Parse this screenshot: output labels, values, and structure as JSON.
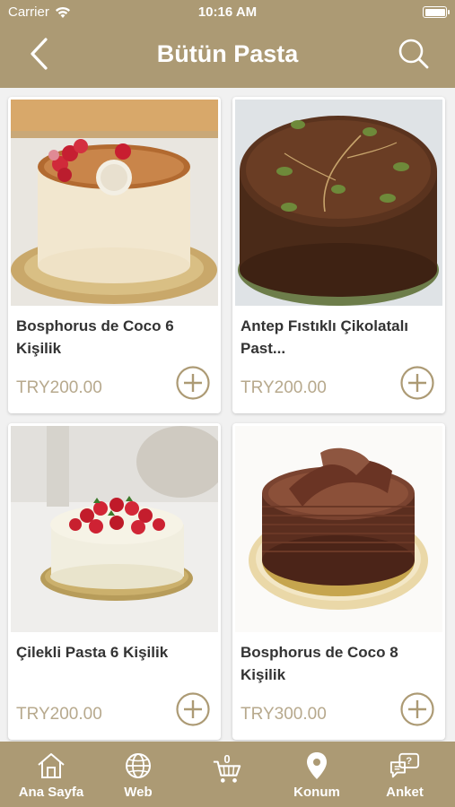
{
  "status_bar": {
    "carrier": "Carrier",
    "time": "10:16 AM"
  },
  "header": {
    "title": "Bütün Pasta",
    "back_icon": "chevron-left-icon",
    "search_icon": "search-icon"
  },
  "products": [
    {
      "name": "Bosphorus de Coco 6 Kişilik",
      "price": "TRY200.00"
    },
    {
      "name": "Antep Fıstıklı Çikolatalı Past...",
      "price": "TRY200.00"
    },
    {
      "name": "Çilekli Pasta 6 Kişilik",
      "price": "TRY200.00"
    },
    {
      "name": "Bosphorus de Coco 8 Kişilik",
      "price": "TRY300.00"
    }
  ],
  "tabbar": {
    "items": [
      {
        "label": "Ana Sayfa",
        "icon": "home-icon"
      },
      {
        "label": "Web",
        "icon": "globe-icon"
      },
      {
        "label": "",
        "icon": "cart-icon",
        "badge": "0"
      },
      {
        "label": "Konum",
        "icon": "location-pin-icon"
      },
      {
        "label": "Anket",
        "icon": "survey-chat-icon"
      }
    ]
  },
  "colors": {
    "brand": "#ac9a74",
    "price": "#b7a98d",
    "background": "#f1f1f1"
  }
}
